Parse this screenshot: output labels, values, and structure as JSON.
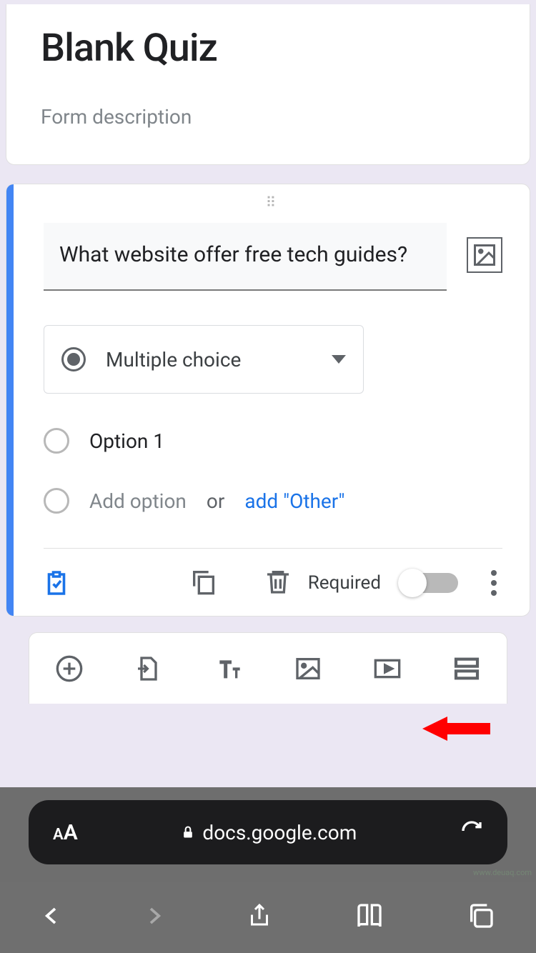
{
  "header": {
    "title": "Blank Quiz",
    "description_placeholder": "Form description"
  },
  "question": {
    "text": "What website offer free tech guides?",
    "type_label": "Multiple choice",
    "options": [
      "Option 1"
    ],
    "add_option_label": "Add option",
    "or_label": "or",
    "add_other_label": "add \"Other\"",
    "required_label": "Required",
    "required_value": false
  },
  "browser": {
    "url": "docs.google.com"
  },
  "watermark": "www.deuaq.com"
}
